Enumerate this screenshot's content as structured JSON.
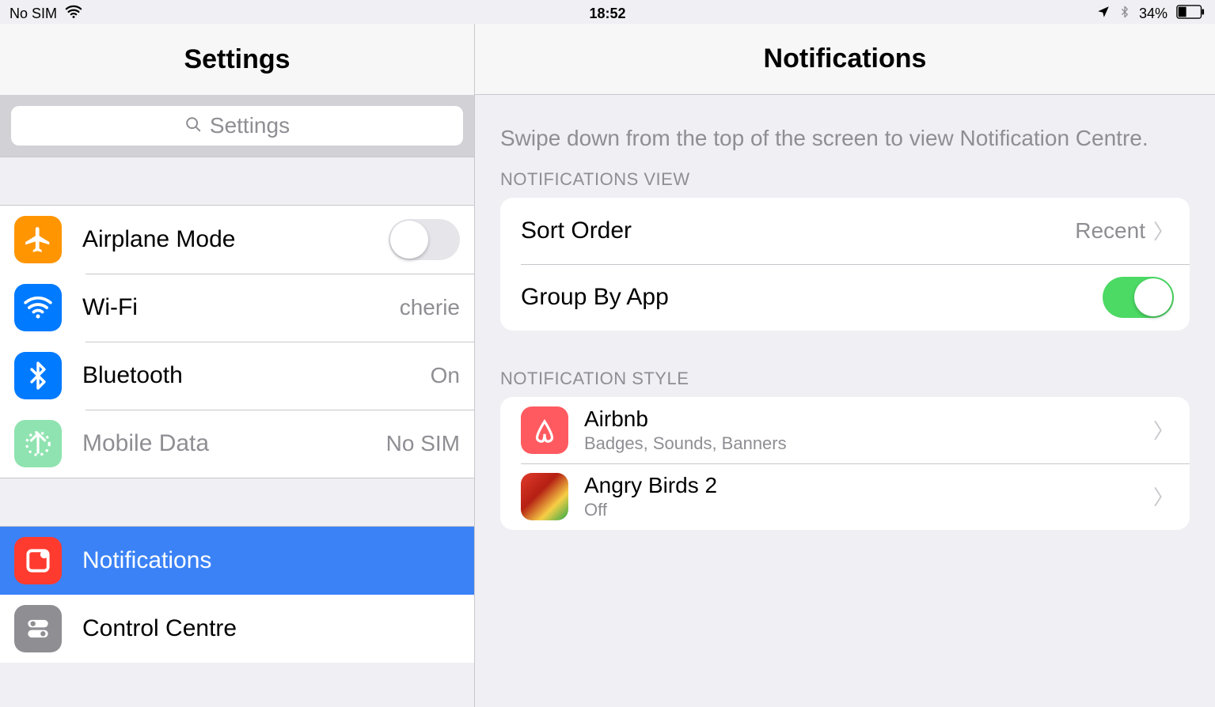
{
  "status": {
    "carrier": "No SIM",
    "time": "18:52",
    "battery_pct": "34%"
  },
  "sidebar": {
    "title": "Settings",
    "search_placeholder": "Settings",
    "items": {
      "airplane": {
        "label": "Airplane Mode",
        "on": false
      },
      "wifi": {
        "label": "Wi-Fi",
        "value": "cherie"
      },
      "bluetooth": {
        "label": "Bluetooth",
        "value": "On"
      },
      "mobiledata": {
        "label": "Mobile Data",
        "value": "No SIM"
      },
      "notifications": {
        "label": "Notifications"
      },
      "control": {
        "label": "Control Centre"
      }
    }
  },
  "detail": {
    "title": "Notifications",
    "hint": "Swipe down from the top of the screen to view Notification Centre.",
    "sections": {
      "view": {
        "header": "NOTIFICATIONS VIEW",
        "sort_label": "Sort Order",
        "sort_value": "Recent",
        "group_label": "Group By App",
        "group_on": true
      },
      "style": {
        "header": "NOTIFICATION STYLE",
        "apps": [
          {
            "name": "Airbnb",
            "sub": "Badges, Sounds, Banners"
          },
          {
            "name": "Angry Birds 2",
            "sub": "Off"
          }
        ]
      }
    }
  }
}
